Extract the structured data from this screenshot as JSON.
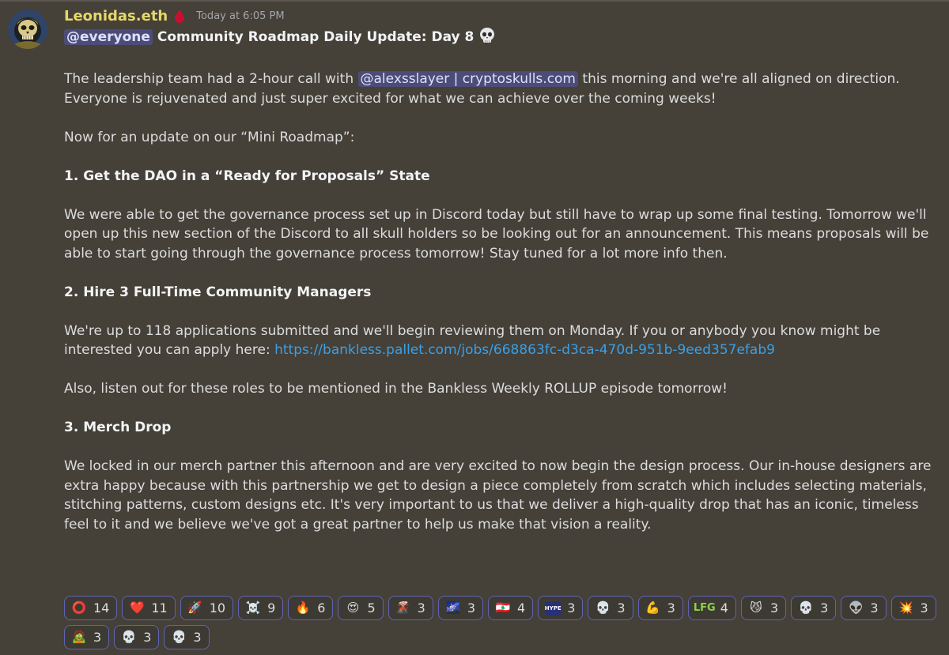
{
  "message": {
    "author": "Leonidas.eth",
    "timestamp": "Today at 6:05 PM",
    "title_mention": "@everyone",
    "title_text": "Community Roadmap Daily Update: Day 8",
    "p1_before": "The leadership team had a 2-hour call with ",
    "p1_mention": "@alexsslayer | cryptoskulls.com",
    "p1_after": " this morning and we're all aligned on direction. Everyone is rejuvenated and just super excited for what we can achieve over the coming weeks!",
    "p2": "Now for an update on our “Mini Roadmap”:",
    "h1": "1. Get the DAO in a “Ready for Proposals” State",
    "p3": "We were able to get the governance process set up in Discord today but still have to wrap up some final testing. Tomorrow we'll open up this new section of the Discord to all skull holders so be looking out for an announcement. This means proposals will be able to start going through the governance process tomorrow! Stay tuned for a lot more info then.",
    "h2": "2. Hire 3 Full-Time Community Managers",
    "p4_before": "We're up to 118 applications submitted and we'll begin reviewing them on Monday. If you or anybody you know might be interested you can apply here: ",
    "p4_link": "https://bankless.pallet.com/jobs/668863fc-d3ca-470d-951b-9eed357efab9",
    "p5": "Also, listen out for these roles to be mentioned in the Bankless Weekly ROLLUP episode tomorrow!",
    "h3": "3. Merch Drop",
    "p6": "We locked in our merch partner this afternoon and are very excited to now begin the design process. Our in-house designers are extra happy because with this partnership we get to design a piece completely from scratch which includes selecting materials, stitching patterns, custom designs etc. It's very important to us that we deliver a high-quality drop that has an iconic, timeless feel to it and we believe we've got a great partner to help us make that vision a reality."
  },
  "reactions": [
    {
      "icon": "bankless-badge-icon",
      "glyph": "⭕",
      "count": "14"
    },
    {
      "icon": "heart-icon",
      "glyph": "❤️",
      "count": "11"
    },
    {
      "icon": "rocket-icon",
      "glyph": "🚀",
      "count": "10"
    },
    {
      "icon": "skull-crossbones-icon",
      "glyph": "☠️",
      "count": "9"
    },
    {
      "icon": "fire-heart-icon",
      "glyph": "🔥",
      "count": "6"
    },
    {
      "icon": "heart-eyes-skull-icon",
      "glyph": "😍",
      "count": "5"
    },
    {
      "icon": "volcano-icon",
      "glyph": "🌋",
      "count": "3"
    },
    {
      "icon": "planet-icon",
      "glyph": "🌌",
      "count": "3"
    },
    {
      "icon": "lebanon-flag-icon",
      "glyph": "🇱🇧",
      "count": "4"
    },
    {
      "icon": "hype-icon",
      "glyph": "HYPE",
      "count": "3"
    },
    {
      "icon": "skull-icon",
      "glyph": "💀",
      "count": "3"
    },
    {
      "icon": "flexed-biceps-icon",
      "glyph": "💪",
      "count": "3"
    },
    {
      "icon": "lfg-icon",
      "glyph": "LFG",
      "count": "4"
    },
    {
      "icon": "cat-icon",
      "glyph": "😼",
      "count": "3"
    },
    {
      "icon": "pixel-skull-icon",
      "glyph": "💀",
      "count": "3"
    },
    {
      "icon": "alien-skull-icon",
      "glyph": "👽",
      "count": "3"
    },
    {
      "icon": "explosion-icon",
      "glyph": "💥",
      "count": "3"
    },
    {
      "icon": "zombie-skull-icon",
      "glyph": "🧟",
      "count": "3"
    },
    {
      "icon": "green-skull-icon",
      "glyph": "💀",
      "count": "3"
    },
    {
      "icon": "gold-skull-icon",
      "glyph": "💀",
      "count": "3"
    }
  ],
  "colors": {
    "background": "#454038",
    "username": "#e6d86a",
    "mention_bg": "#5865f2",
    "link": "#3aa0e6",
    "reaction_border": "#5f64b3"
  }
}
